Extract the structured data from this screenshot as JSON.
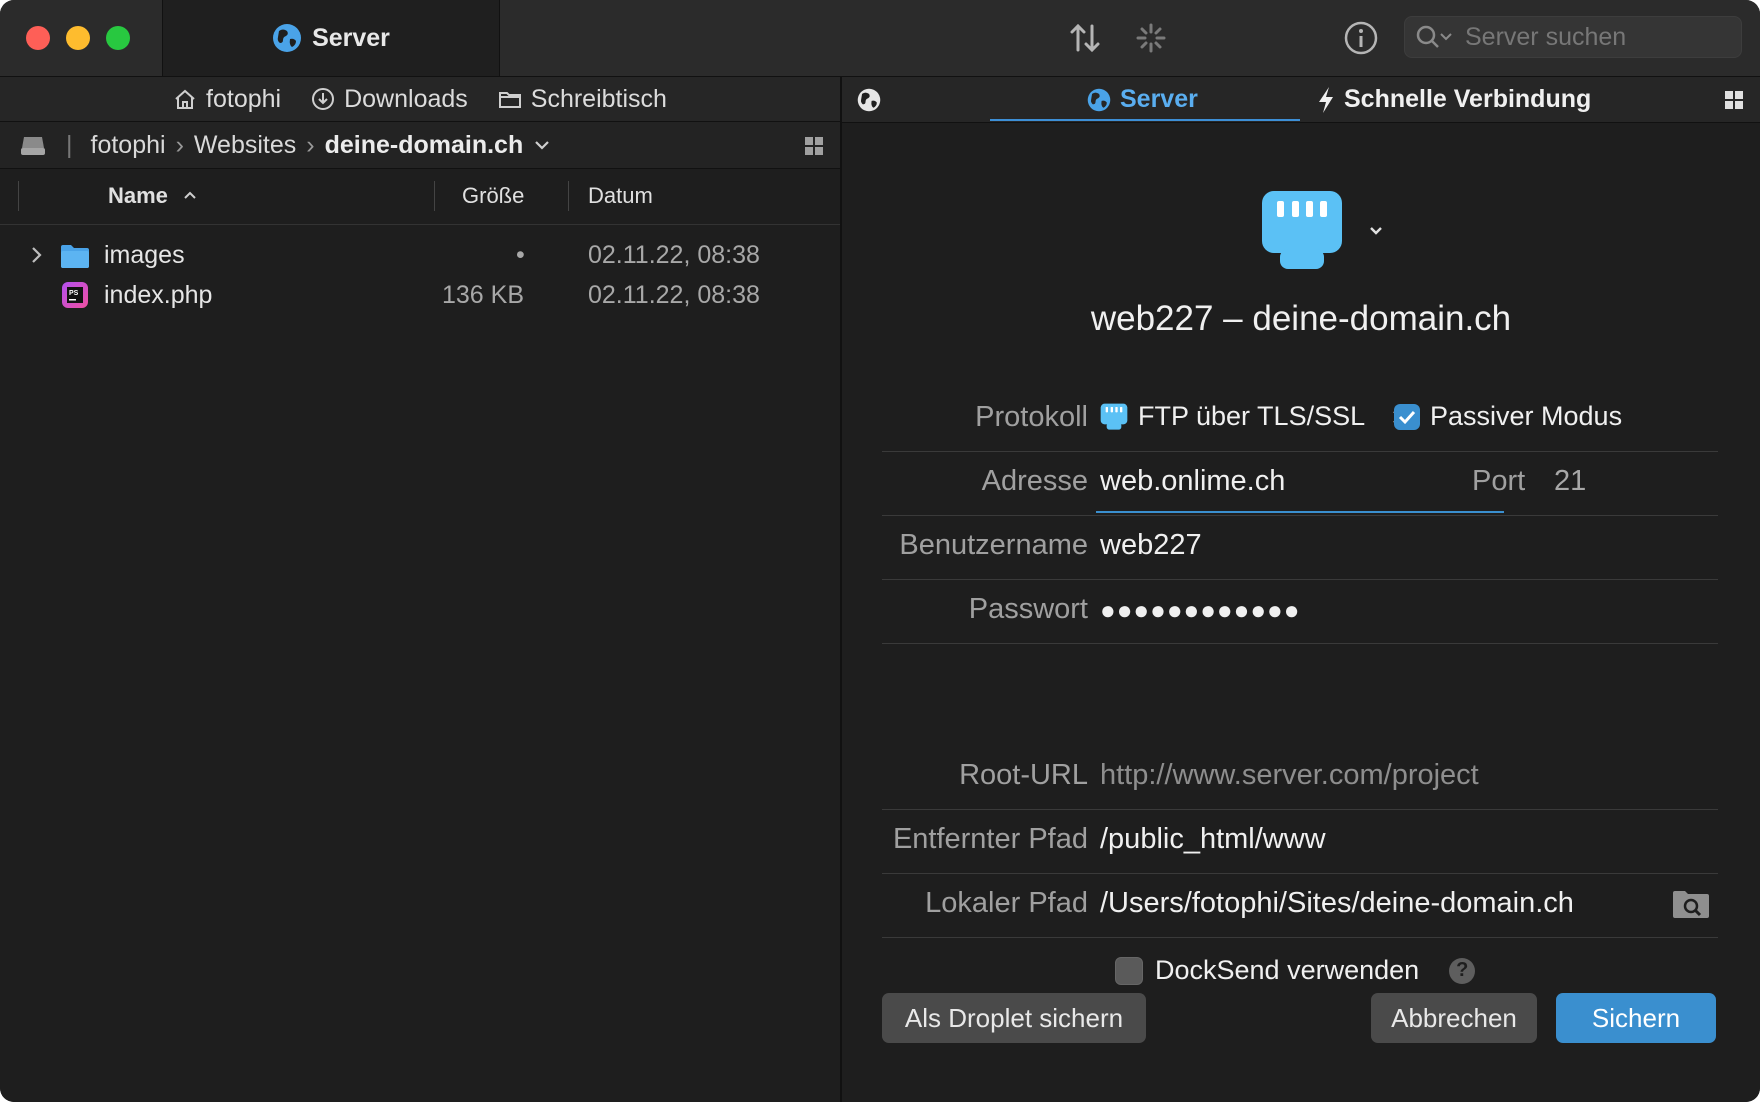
{
  "window": {
    "tab_title": "Server",
    "search_placeholder": "Server suchen"
  },
  "favorites": [
    {
      "label": "fotophi",
      "icon": "home-icon"
    },
    {
      "label": "Downloads",
      "icon": "download-icon"
    },
    {
      "label": "Schreibtisch",
      "icon": "folder-icon"
    }
  ],
  "breadcrumb": {
    "items": [
      "fotophi",
      "Websites",
      "deine-domain.ch"
    ]
  },
  "file_list": {
    "columns": {
      "name": "Name",
      "size": "Größe",
      "date": "Datum"
    },
    "rows": [
      {
        "name": "images",
        "size": "•",
        "date": "02.11.22, 08:38",
        "type": "folder"
      },
      {
        "name": "index.php",
        "size": "136 KB",
        "date": "02.11.22, 08:38",
        "type": "php"
      }
    ]
  },
  "right_tabs": {
    "server": "Server",
    "quick": "Schnelle Verbindung"
  },
  "server_form": {
    "title": "web227 – deine-domain.ch",
    "protocol_label": "Protokoll",
    "protocol_value": "FTP über TLS/SSL",
    "passive_label": "Passiver Modus",
    "passive_checked": true,
    "address_label": "Adresse",
    "address_value": "web.onlime.ch",
    "port_label": "Port",
    "port_value": "21",
    "user_label": "Benutzername",
    "user_value": "web227",
    "password_label": "Passwort",
    "password_value": "●●●●●●●●●●●●",
    "root_url_label": "Root-URL",
    "root_url_placeholder": "http://www.server.com/project",
    "remote_path_label": "Entfernter Pfad",
    "remote_path_value": "/public_html/www",
    "local_path_label": "Lokaler Pfad",
    "local_path_value": "/Users/fotophi/Sites/deine-domain.ch",
    "docksend_label": "DockSend verwenden",
    "docksend_checked": false,
    "help_symbol": "?"
  },
  "buttons": {
    "droplet": "Als Droplet sichern",
    "cancel": "Abbrechen",
    "save": "Sichern"
  },
  "colors": {
    "accent": "#3a8fcf",
    "folder": "#4aa3e8"
  }
}
